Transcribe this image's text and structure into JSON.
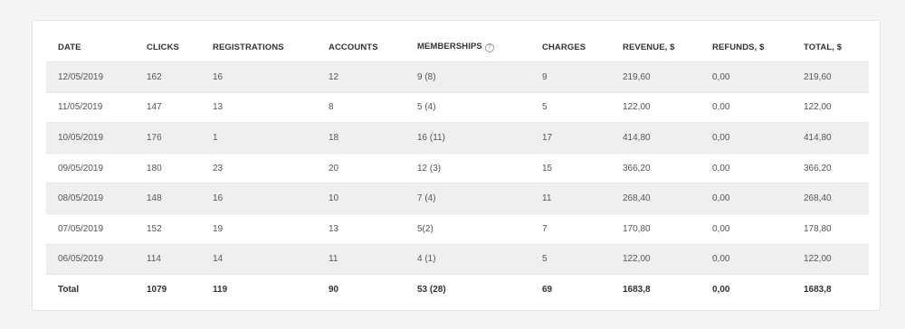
{
  "table": {
    "headers": {
      "date": "DATE",
      "clicks": "CLICKS",
      "registrations": "REGISTRATIONS",
      "accounts": "ACCOUNTS",
      "memberships": "MEMBERSHIPS",
      "memberships_help_icon": "?",
      "charges": "CHARGES",
      "revenue": "REVENUE, $",
      "refunds": "REFUNDS, $",
      "total": "TOTAL, $"
    },
    "rows": [
      [
        "12/05/2019",
        "162",
        "16",
        "12",
        "9 (8)",
        "9",
        "219,60",
        "0,00",
        "219,60"
      ],
      [
        "11/05/2019",
        "147",
        "13",
        "8",
        "5 (4)",
        "5",
        "122,00",
        "0,00",
        "122,00"
      ],
      [
        "10/05/2019",
        "176",
        "1",
        "18",
        "16 (11)",
        "17",
        "414,80",
        "0,00",
        "414,80"
      ],
      [
        "09/05/2019",
        "180",
        "23",
        "20",
        "12 (3)",
        "15",
        "366,20",
        "0,00",
        "366,20"
      ],
      [
        "08/05/2019",
        "148",
        "16",
        "10",
        "7 (4)",
        "11",
        "268,40",
        "0,00",
        "268,40"
      ],
      [
        "07/05/2019",
        "152",
        "19",
        "13",
        "5(2)",
        "7",
        "170,80",
        "0,00",
        "178,80"
      ],
      [
        "06/05/2019",
        "114",
        "14",
        "11",
        "4 (1)",
        "5",
        "122,00",
        "0,00",
        "122,00"
      ]
    ],
    "totals": [
      "Total",
      "1079",
      "119",
      "90",
      "53 (28)",
      "69",
      "1683,8",
      "0,00",
      "1683,8"
    ]
  }
}
